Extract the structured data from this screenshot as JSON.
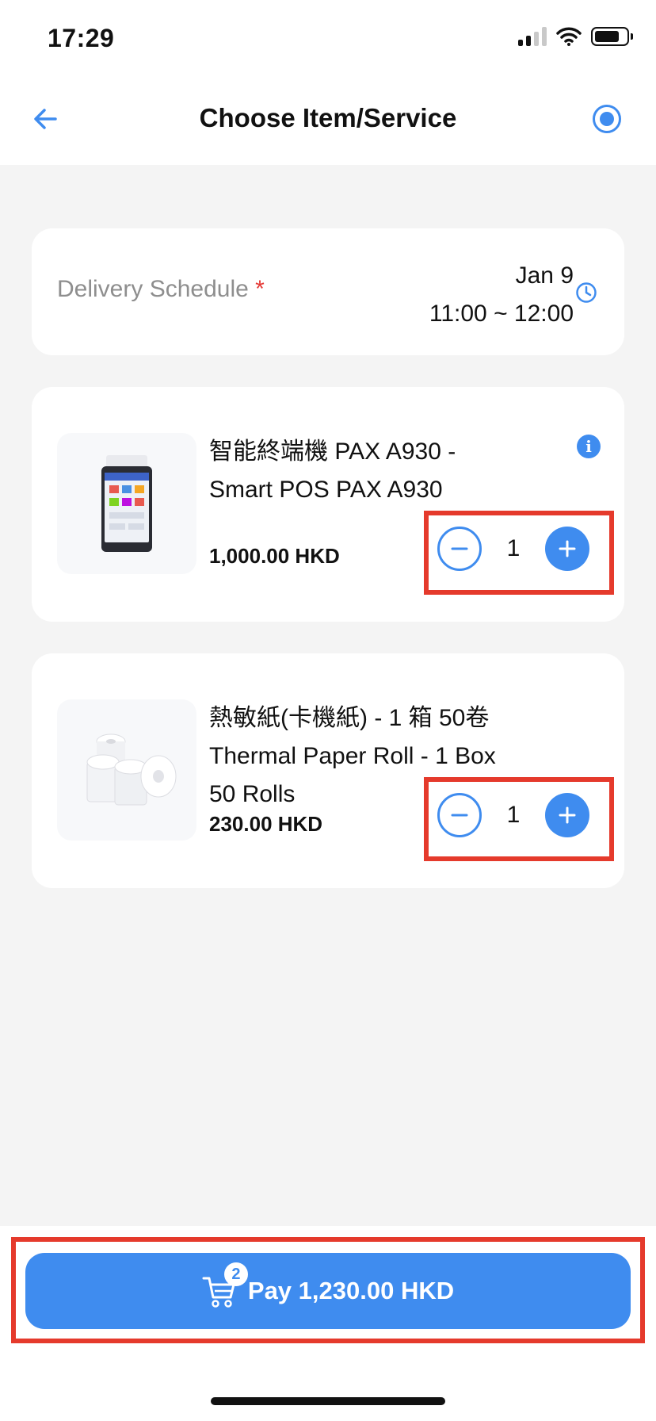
{
  "status_bar": {
    "time": "17:29"
  },
  "header": {
    "title": "Choose Item/Service"
  },
  "delivery": {
    "label": "Delivery Schedule",
    "required_mark": "*",
    "date": "Jan 9",
    "time_range": "11:00 ~ 12:00"
  },
  "items": [
    {
      "name_zh": "智能終端機 PAX A930 -",
      "name_en": "Smart POS PAX A930",
      "price": "1,000.00 HKD",
      "quantity": "1",
      "info_icon": "i"
    },
    {
      "name_zh": "熱敏紙(卡機紙) - 1 箱 50卷",
      "name_en": "Thermal Paper Roll - 1 Box",
      "name_en_2": "50 Rolls",
      "price": "230.00 HKD",
      "quantity": "1"
    }
  ],
  "footer": {
    "cart_count": "2",
    "pay_label": "Pay 1,230.00 HKD"
  },
  "colors": {
    "accent": "#3f8cef",
    "highlight": "#e53a2c",
    "required": "#e53935"
  }
}
